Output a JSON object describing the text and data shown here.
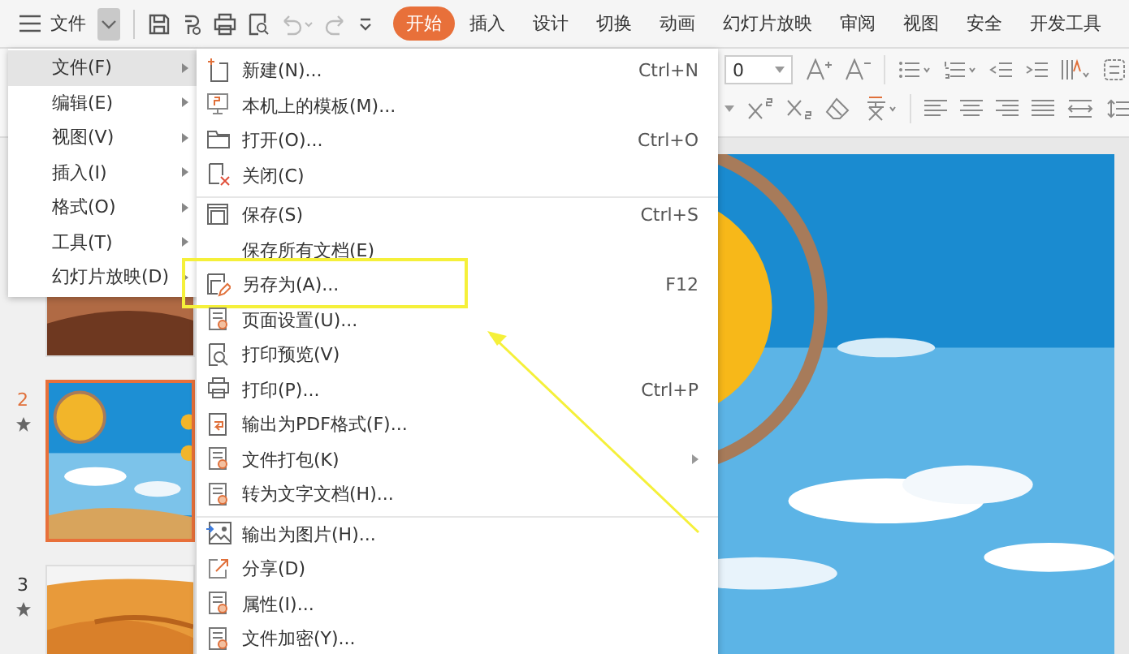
{
  "quick_access": {
    "menu_label": "文件",
    "undo_disabled": true,
    "redo_disabled": true
  },
  "tabs": [
    {
      "label": "开始",
      "selected": true
    },
    {
      "label": "插入",
      "selected": false
    },
    {
      "label": "设计",
      "selected": false
    },
    {
      "label": "切换",
      "selected": false
    },
    {
      "label": "动画",
      "selected": false
    },
    {
      "label": "幻灯片放映",
      "selected": false
    },
    {
      "label": "审阅",
      "selected": false
    },
    {
      "label": "视图",
      "selected": false
    },
    {
      "label": "安全",
      "selected": false
    },
    {
      "label": "开发工具",
      "selected": false
    }
  ],
  "ribbon": {
    "font_size": "0"
  },
  "slides": [
    {
      "selected": false
    },
    {
      "number": "2",
      "selected": true
    },
    {
      "number": "3",
      "selected": false
    }
  ],
  "main_menu": [
    {
      "label": "文件(F)",
      "selected": true
    },
    {
      "label": "编辑(E)",
      "selected": false
    },
    {
      "label": "视图(V)",
      "selected": false
    },
    {
      "label": "插入(I)",
      "selected": false
    },
    {
      "label": "格式(O)",
      "selected": false
    },
    {
      "label": "工具(T)",
      "selected": false
    },
    {
      "label": "幻灯片放映(D)",
      "selected": false
    }
  ],
  "file_menu": [
    {
      "label": "新建(N)...",
      "shortcut": "Ctrl+N",
      "separator_before": false,
      "submenu": false,
      "highlighted": false
    },
    {
      "label": "本机上的模板(M)...",
      "separator_before": false,
      "submenu": false,
      "highlighted": false
    },
    {
      "label": "打开(O)...",
      "shortcut": "Ctrl+O",
      "separator_before": false,
      "submenu": false,
      "highlighted": false
    },
    {
      "label": "关闭(C)",
      "separator_before": false,
      "submenu": false,
      "highlighted": false
    },
    {
      "label": "保存(S)",
      "shortcut": "Ctrl+S",
      "separator_before": true,
      "submenu": false,
      "highlighted": false
    },
    {
      "label": "保存所有文档(E)",
      "separator_before": false,
      "submenu": false,
      "highlighted": false
    },
    {
      "label": "另存为(A)...",
      "shortcut": "F12",
      "separator_before": false,
      "submenu": false,
      "highlighted": true
    },
    {
      "label": "页面设置(U)...",
      "separator_before": false,
      "submenu": false,
      "highlighted": false
    },
    {
      "label": "打印预览(V)",
      "separator_before": false,
      "submenu": false,
      "highlighted": false
    },
    {
      "label": "打印(P)...",
      "shortcut": "Ctrl+P",
      "separator_before": false,
      "submenu": false,
      "highlighted": false
    },
    {
      "label": "输出为PDF格式(F)...",
      "separator_before": false,
      "submenu": false,
      "highlighted": false
    },
    {
      "label": "文件打包(K)",
      "separator_before": false,
      "submenu": true,
      "highlighted": false
    },
    {
      "label": "转为文字文档(H)...",
      "separator_before": false,
      "submenu": false,
      "highlighted": false
    },
    {
      "label": "输出为图片(H)...",
      "separator_before": true,
      "submenu": false,
      "highlighted": false
    },
    {
      "label": "分享(D)",
      "separator_before": false,
      "submenu": false,
      "highlighted": false
    },
    {
      "label": "属性(I)...",
      "separator_before": false,
      "submenu": false,
      "highlighted": false
    },
    {
      "label": "文件加密(Y)...",
      "separator_before": false,
      "submenu": false,
      "highlighted": false
    }
  ]
}
